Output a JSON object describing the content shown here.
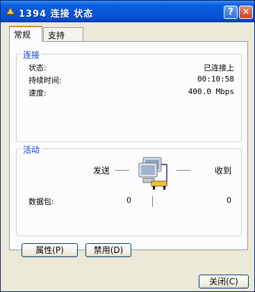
{
  "window": {
    "title": "1394 连接 状态",
    "help_label": "?",
    "close_label": "✕"
  },
  "tabs": [
    {
      "label": "常规",
      "active": true
    },
    {
      "label": "支持",
      "active": false
    }
  ],
  "connection": {
    "title": "连接",
    "rows": [
      {
        "label": "状态:",
        "value": "已连接上"
      },
      {
        "label": "持续时间:",
        "value": "00:10:58"
      },
      {
        "label": "速度:",
        "value": "400.0 Mbps"
      }
    ]
  },
  "activity": {
    "title": "活动",
    "sent_label": "发送",
    "received_label": "收到",
    "packets_label": "数据包:",
    "packets_sent": "0",
    "packets_received": "0",
    "icon": "network-computer-icon"
  },
  "buttons": {
    "properties": "属性(P)",
    "disable": "禁用(D)",
    "close": "关闭(C)"
  },
  "colors": {
    "titlebar": "#0655d8",
    "group_title": "#0046d5",
    "dialog_bg": "#ece9d8"
  }
}
